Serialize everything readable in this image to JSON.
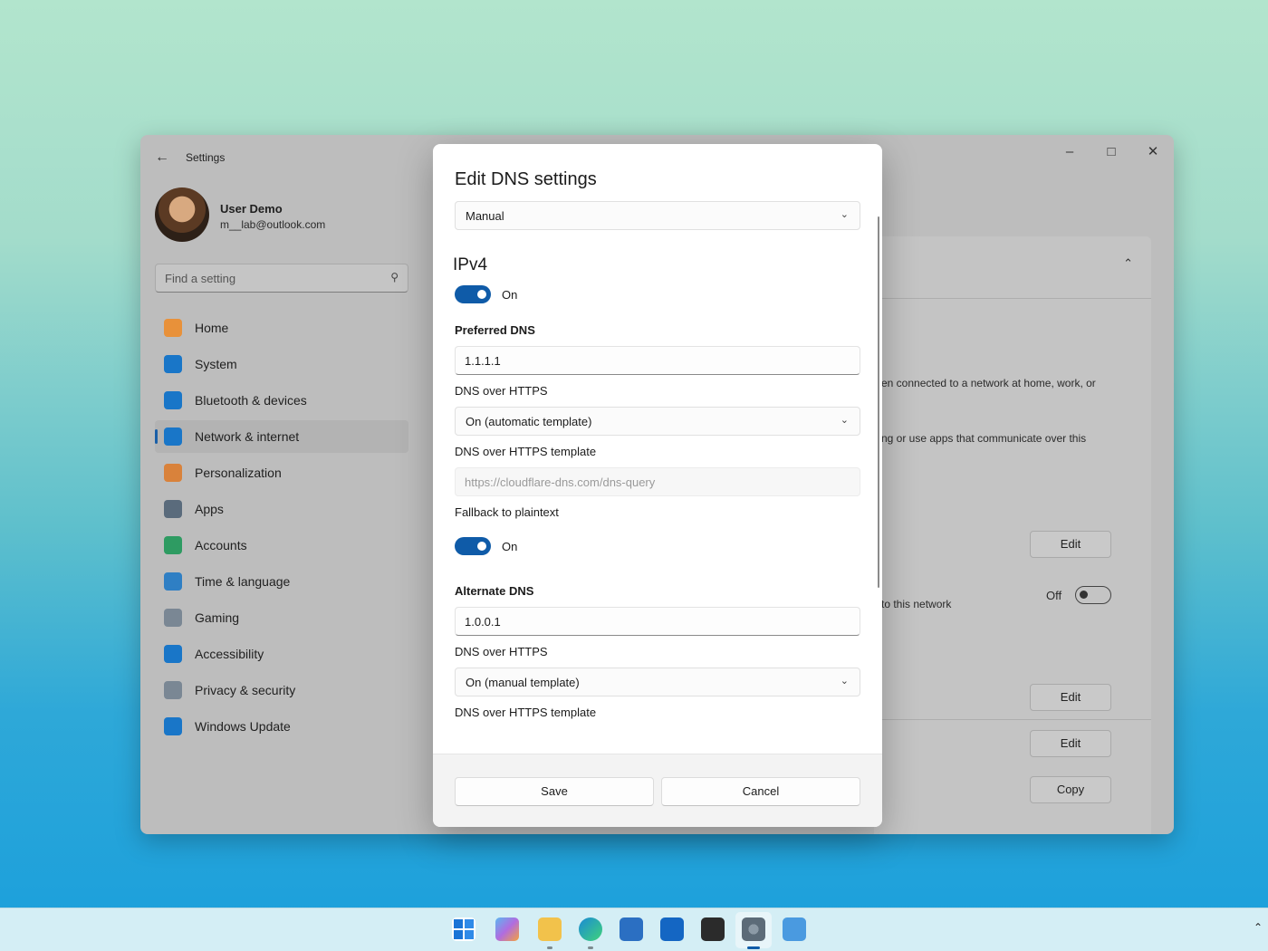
{
  "window": {
    "title": "Settings",
    "user": {
      "name": "User Demo",
      "email": "m__lab@outlook.com"
    },
    "search": {
      "placeholder": "Find a setting"
    },
    "nav": [
      {
        "label": "Home",
        "icon": "home-icon",
        "color": "#e8913a"
      },
      {
        "label": "System",
        "icon": "system-icon",
        "color": "#1976c8"
      },
      {
        "label": "Bluetooth & devices",
        "icon": "bluetooth-icon",
        "color": "#1976c8"
      },
      {
        "label": "Network & internet",
        "icon": "network-icon",
        "color": "#1976c8",
        "active": true
      },
      {
        "label": "Personalization",
        "icon": "brush-icon",
        "color": "#d9823b"
      },
      {
        "label": "Apps",
        "icon": "apps-icon",
        "color": "#5a6b7c"
      },
      {
        "label": "Accounts",
        "icon": "accounts-icon",
        "color": "#2e9b62"
      },
      {
        "label": "Time & language",
        "icon": "globe-icon",
        "color": "#2f7fc4"
      },
      {
        "label": "Gaming",
        "icon": "gamepad-icon",
        "color": "#7a8794"
      },
      {
        "label": "Accessibility",
        "icon": "accessibility-icon",
        "color": "#1976c8"
      },
      {
        "label": "Privacy & security",
        "icon": "shield-icon",
        "color": "#7a8794"
      },
      {
        "label": "Windows Update",
        "icon": "update-icon",
        "color": "#1976c8"
      }
    ],
    "background": {
      "text1": "en connected to a network at home, work, or",
      "text2": "ng or use apps that communicate over this",
      "text3": "to this network",
      "toggle_label": "Off",
      "edit1": "Edit",
      "edit2": "Edit",
      "edit3": "Edit",
      "copy": "Copy"
    }
  },
  "dialog": {
    "title": "Edit DNS settings",
    "mode": "Manual",
    "ipv4": {
      "heading": "IPv4",
      "toggle_label": "On",
      "preferred_label": "Preferred DNS",
      "preferred_value": "1.1.1.1",
      "doh_label": "DNS over HTTPS",
      "doh_value": "On (automatic template)",
      "template_label": "DNS over HTTPS template",
      "template_placeholder": "https://cloudflare-dns.com/dns-query",
      "fallback_label": "Fallback to plaintext",
      "fallback_toggle": "On",
      "alternate_label": "Alternate DNS",
      "alternate_value": "1.0.0.1",
      "alt_doh_label": "DNS over HTTPS",
      "alt_doh_value": "On (manual template)",
      "alt_template_label": "DNS over HTTPS template"
    },
    "save_label": "Save",
    "cancel_label": "Cancel"
  },
  "taskbar": {
    "icons": [
      "start-icon",
      "copilot-icon",
      "file-explorer-icon",
      "edge-icon",
      "store-icon",
      "outlook-icon",
      "terminal-icon",
      "settings-icon",
      "notepad-icon"
    ]
  },
  "colors": {
    "accent": "#0f5ba8"
  }
}
